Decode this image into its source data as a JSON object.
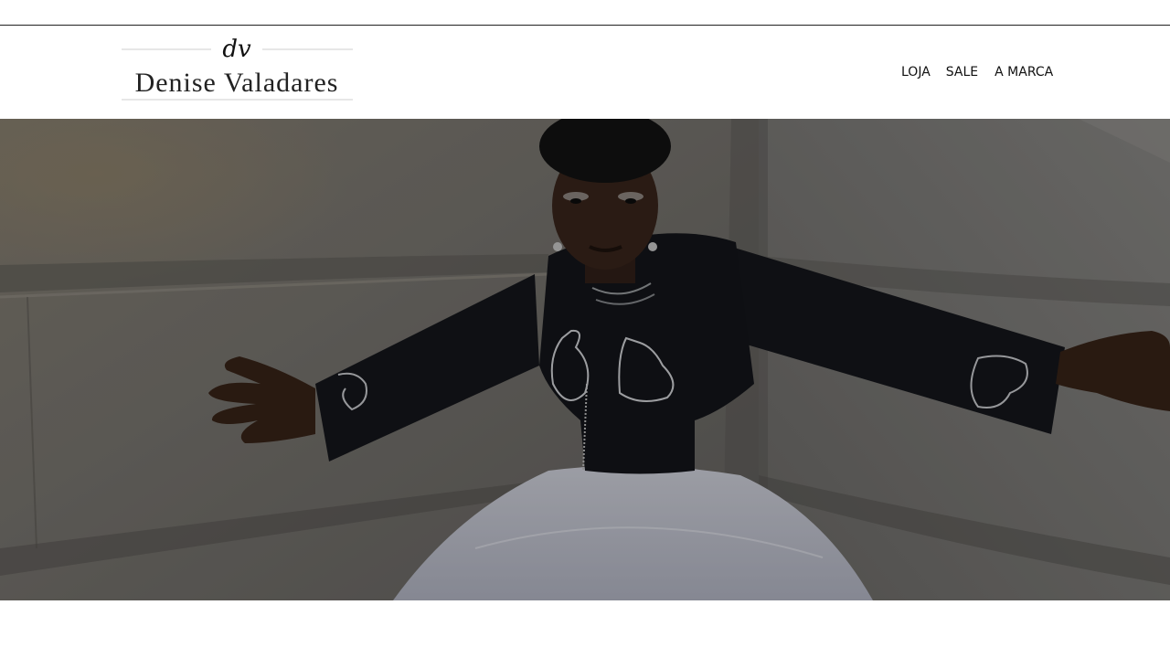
{
  "brand": {
    "monogram": "dv",
    "name": "Denise Valadares"
  },
  "nav": {
    "items": [
      {
        "label": "LOJA"
      },
      {
        "label": "SALE"
      },
      {
        "label": "A MARCA"
      }
    ]
  },
  "hero": {
    "image_subject": "model-in-black-embroidered-jacket-and-white-tulle-skirt-against-stone-wall",
    "overlay_color": "#000000"
  },
  "colors": {
    "background": "#ffffff",
    "text": "#111111",
    "rule": "#222222"
  }
}
